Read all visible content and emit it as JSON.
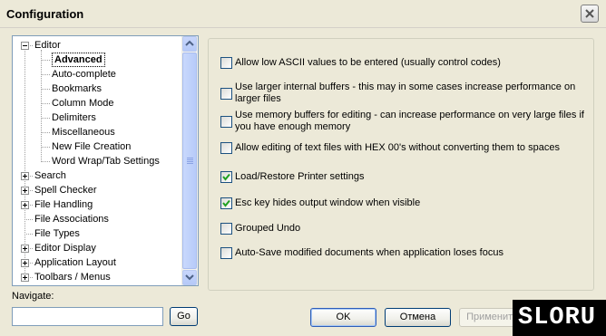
{
  "window": {
    "title": "Configuration"
  },
  "tree": {
    "items": [
      {
        "label": "Editor",
        "level": 0,
        "expanded": true
      },
      {
        "label": "Advanced",
        "level": 1,
        "selected": true
      },
      {
        "label": "Auto-complete",
        "level": 1
      },
      {
        "label": "Bookmarks",
        "level": 1
      },
      {
        "label": "Column Mode",
        "level": 1
      },
      {
        "label": "Delimiters",
        "level": 1
      },
      {
        "label": "Miscellaneous",
        "level": 1
      },
      {
        "label": "New File Creation",
        "level": 1
      },
      {
        "label": "Word Wrap/Tab Settings",
        "level": 1
      },
      {
        "label": "Search",
        "level": 0,
        "expandable": true
      },
      {
        "label": "Spell Checker",
        "level": 0,
        "expandable": true
      },
      {
        "label": "File Handling",
        "level": 0,
        "expandable": true
      },
      {
        "label": "File Associations",
        "level": 0
      },
      {
        "label": "File Types",
        "level": 0
      },
      {
        "label": "Editor Display",
        "level": 0,
        "expandable": true
      },
      {
        "label": "Application Layout",
        "level": 0,
        "expandable": true
      },
      {
        "label": "Toolbars / Menus",
        "level": 0,
        "expandable": true
      }
    ]
  },
  "options": [
    {
      "label": "Allow low ASCII values to be entered (usually control codes)",
      "checked": false
    },
    {
      "label": "Use larger internal buffers - this may in some cases increase performance on larger files",
      "checked": false
    },
    {
      "label": "Use memory buffers for editing - can increase performance on very large files if you have enough memory",
      "checked": false
    },
    {
      "label": "Allow editing of text files with HEX 00's without converting them to spaces",
      "checked": false
    },
    {
      "label": "Load/Restore Printer settings",
      "checked": true
    },
    {
      "label": "Esc key hides output window when visible",
      "checked": true
    },
    {
      "label": "Grouped Undo",
      "checked": false
    },
    {
      "label": "Auto-Save modified documents when application loses focus",
      "checked": false
    }
  ],
  "navigate": {
    "label": "Navigate:",
    "value": "",
    "go_label": "Go"
  },
  "buttons": {
    "ok": "OK",
    "cancel": "Отмена",
    "apply": "Применить"
  },
  "watermark": {
    "text": "SLORU"
  }
}
